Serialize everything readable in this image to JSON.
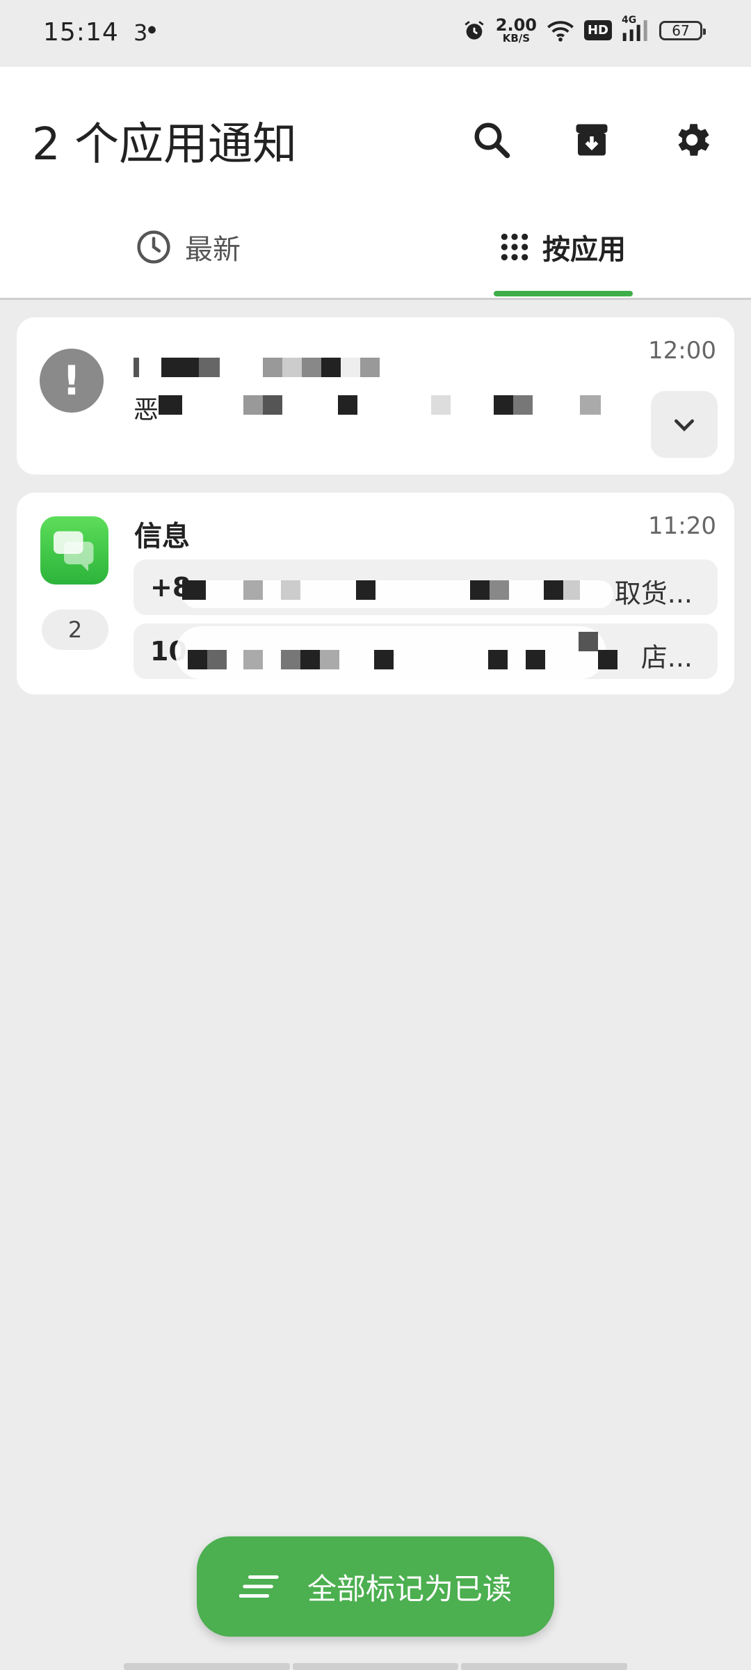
{
  "status_bar": {
    "time": "15:14",
    "extra": "3",
    "net_speed_value": "2.00",
    "net_speed_unit": "KB/S",
    "hd_label": "HD",
    "signal_label": "4G",
    "battery_level": "67"
  },
  "header": {
    "title": "2 个应用通知"
  },
  "tabs": [
    {
      "label": "最新",
      "icon": "clock-icon",
      "active": false
    },
    {
      "label": "按应用",
      "icon": "grid-icon",
      "active": true
    }
  ],
  "notifications": [
    {
      "icon": "alert-icon",
      "line1_prefix": "",
      "line2_prefix": "恶",
      "time": "12:00"
    },
    {
      "app_name": "信息",
      "icon": "messages-app-icon",
      "count": "2",
      "time": "11:20",
      "messages": [
        {
          "sender": "+8",
          "tail": "取货..."
        },
        {
          "sender": "10",
          "tail": "店..."
        }
      ]
    }
  ],
  "actions": {
    "mark_all_read": "全部标记为已读"
  },
  "colors": {
    "accent": "#4caf50",
    "tab_indicator": "#3fae49",
    "background": "#ececec"
  }
}
